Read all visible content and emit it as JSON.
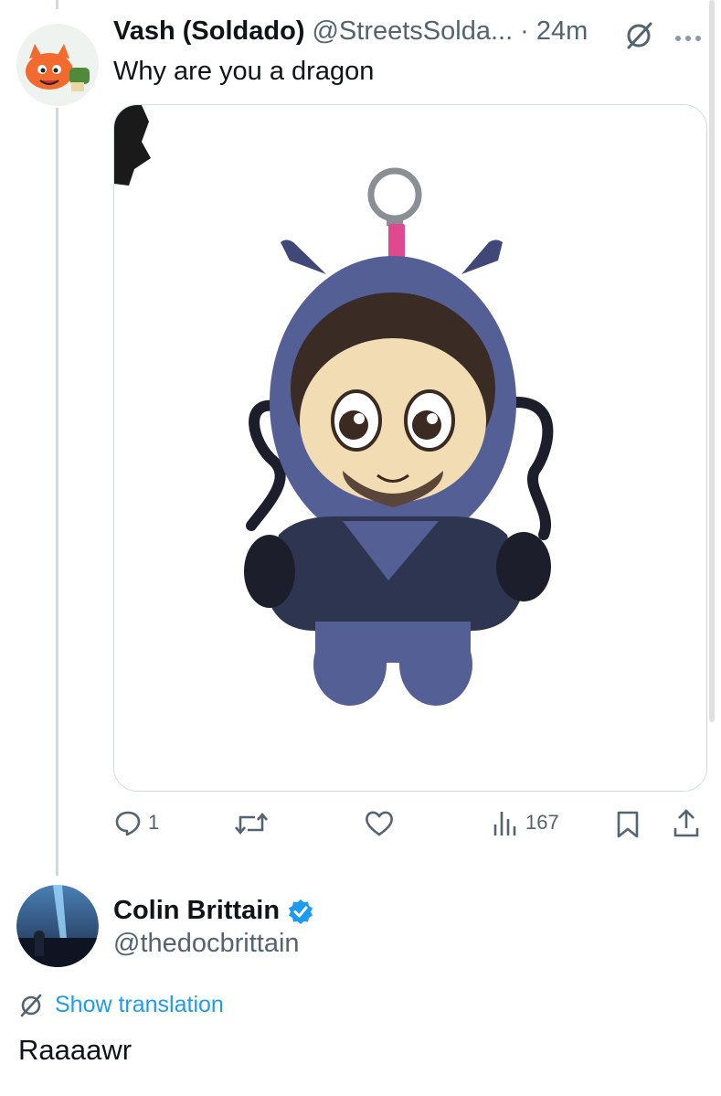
{
  "reply": {
    "author_name": "Vash (Soldado)",
    "author_handle": "@StreetsSolda...",
    "separator": "·",
    "time": "24m",
    "text": "Why are you a dragon",
    "actions": {
      "reply_count": "1",
      "views_count": "167"
    }
  },
  "main_post": {
    "author_name": "Colin Brittain",
    "author_handle": "@thedocbrittain",
    "verified": true,
    "translate_label": "Show translation",
    "text": "Raaaawr"
  },
  "colors": {
    "accent": "#1d9bf0",
    "muted": "#536471",
    "border": "#cfd9de",
    "plush_body": "#4f5a8c"
  },
  "icons": [
    "grok-icon",
    "more-icon",
    "reply-icon",
    "retweet-icon",
    "like-icon",
    "views-icon",
    "bookmark-icon",
    "share-icon",
    "verified-icon",
    "translate-icon"
  ]
}
